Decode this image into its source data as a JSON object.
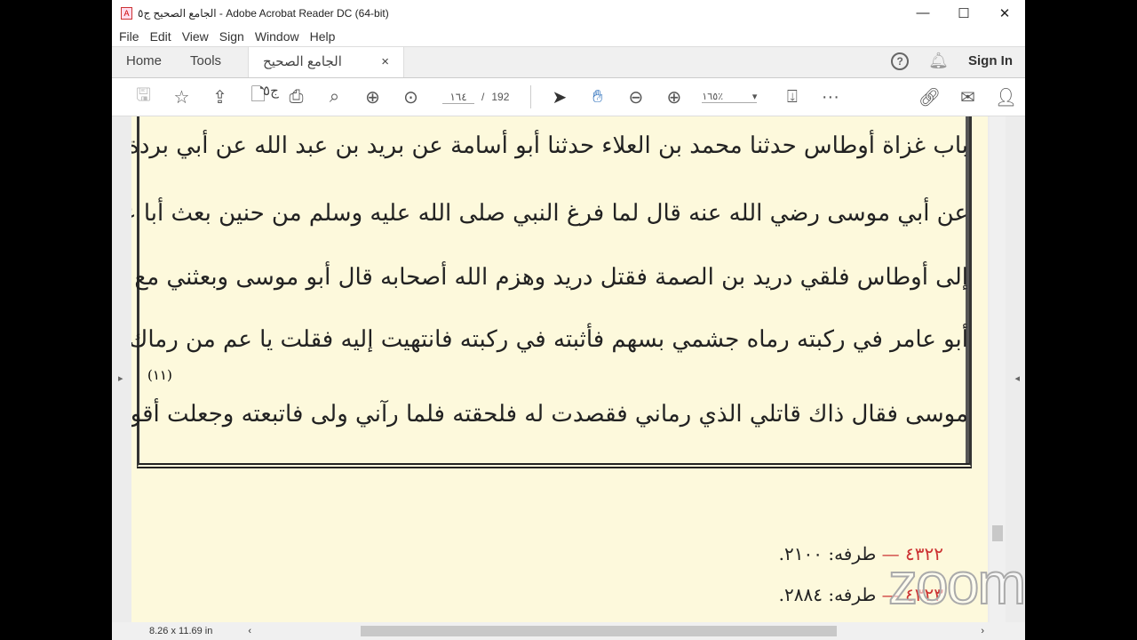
{
  "window": {
    "title": "الجامع الصحيح ج٥ - Adobe Acrobat Reader DC (64-bit)",
    "minimize": "—",
    "maximize": "☐",
    "close": "✕"
  },
  "menu": [
    "File",
    "Edit",
    "View",
    "Sign",
    "Window",
    "Help"
  ],
  "tabs": {
    "home": "Home",
    "tools": "Tools",
    "document": "الجامع الصحيح ج٥",
    "close": "×",
    "help": "?",
    "sign_in": "Sign In"
  },
  "toolbar": {
    "page_current": "١٦٤",
    "page_separator": "/",
    "page_total": "192",
    "zoom": "١٦٥٪",
    "zoom_arrow": "▾"
  },
  "document": {
    "lines": [
      "باب غزاة أوطاس حدثنا محمد بن العلاء حدثنا أبو أسامة عن بريد بن عبد الله عن أبي بردة",
      "عن أبي موسى رضي الله عنه قال لما فرغ النبي صلى الله عليه وسلم من حنين بعث أبا عامر على جيش",
      "إلى أوطاس فلقي دريد بن الصمة فقتل دريد وهزم الله أصحابه قال أبو موسى وبعثني مع أبي عامر فرمي",
      "أبو عامر في ركبته رماه جشمي بسهم فأثبته في ركبته فانتهيت إليه فقلت يا عم من رماك فأشار إلى أبي",
      "موسى فقال ذاك قاتلي الذي رماني فقصدت له فلحقته فلما رآني ولى فاتبعته وجعلت أقول له ألا تستحي"
    ],
    "note_marker": "(١١)",
    "footnotes": [
      {
        "number": "٤٣٢٢",
        "dash": "—",
        "text": "طرفه: ٢١٠٠."
      },
      {
        "number": "٤٣٢٣",
        "dash": "—",
        "text": "طرفه: ٢٨٨٤."
      }
    ]
  },
  "status": {
    "page_size": "8.26 x 11.69 in"
  },
  "watermark": "zoom"
}
